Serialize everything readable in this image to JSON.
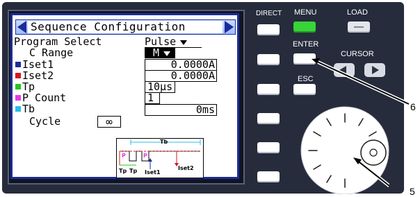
{
  "screen": {
    "title": "Sequence Configuration",
    "rows": [
      {
        "label": "Program Select",
        "value": "Pulse",
        "type": "dropdown"
      },
      {
        "label": "C Range",
        "value": "M",
        "type": "dropdown"
      },
      {
        "label": "Iset1",
        "value": "0.0000A",
        "color": "#1b2c9a"
      },
      {
        "label": "Iset2",
        "value": "0.0000A",
        "color": "#d8141c"
      },
      {
        "label": "Tp",
        "value": "10µs",
        "color": "#22c422"
      },
      {
        "label": "P Count",
        "value": "1",
        "color": "#e23be2"
      },
      {
        "label": "Tb",
        "value": "0ms",
        "color": "#29bde8"
      },
      {
        "label": "Cycle",
        "value": "∞"
      }
    ],
    "diagram": {
      "tb": "Tb",
      "p1": "P",
      "p2": "P",
      "tp1": "Tp",
      "tp2": "Tp",
      "iset1": "Iset1",
      "iset2": "Iset2"
    }
  },
  "controls": {
    "direct_label": "DIRECT",
    "menu_label": "MENU",
    "load_label": "LOAD",
    "enter_label": "ENTER",
    "cursor_label": "CURSOR",
    "esc_label": "ESC"
  },
  "callouts": {
    "enter_callout": "6",
    "knob_callout": "5"
  },
  "colors": {
    "panel": "#262c3c",
    "screen_border": "#1b2c9a",
    "menu_button": "#38d43a"
  }
}
